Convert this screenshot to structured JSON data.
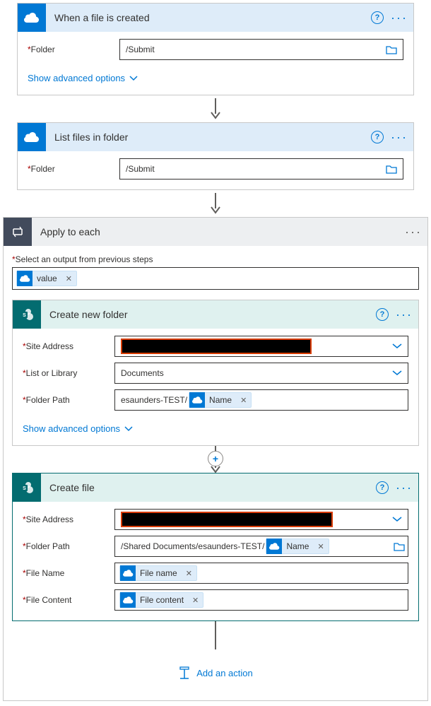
{
  "colors": {
    "accent": "#0078d4",
    "sharepoint": "#036c70",
    "required": "#a80000"
  },
  "step1": {
    "title": "When a file is created",
    "folder_label": "Folder",
    "folder_value": "/Submit",
    "advanced": "Show advanced options"
  },
  "step2": {
    "title": "List files in folder",
    "folder_label": "Folder",
    "folder_value": "/Submit"
  },
  "loop": {
    "title": "Apply to each",
    "select_label": "Select an output from previous steps",
    "token_value": "value",
    "createFolder": {
      "title": "Create new folder",
      "site_label": "Site Address",
      "list_label": "List or Library",
      "list_value": "Documents",
      "path_label": "Folder Path",
      "path_prefix": "esaunders-TEST/",
      "path_token": "Name",
      "advanced": "Show advanced options"
    },
    "createFile": {
      "title": "Create file",
      "site_label": "Site Address",
      "path_label": "Folder Path",
      "path_prefix": "/Shared Documents/esaunders-TEST/",
      "path_token": "Name",
      "name_label": "File Name",
      "name_token": "File name",
      "content_label": "File Content",
      "content_token": "File content"
    },
    "add_action": "Add an action"
  }
}
